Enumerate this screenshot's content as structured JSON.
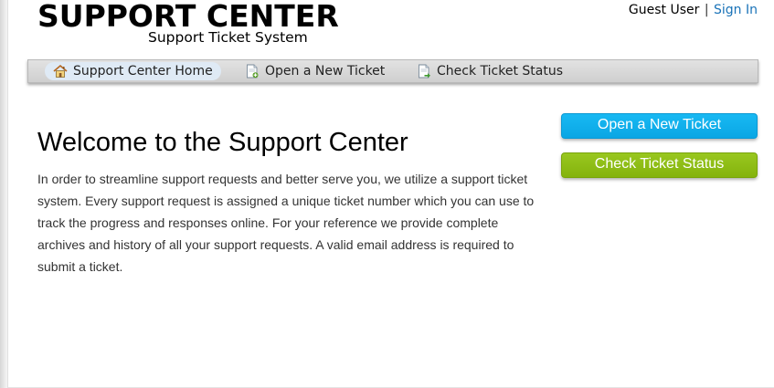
{
  "header": {
    "title": "SUPPORT CENTER",
    "subtitle": "Support Ticket System",
    "user_label": "Guest User",
    "separator": "|",
    "sign_in_label": "Sign In"
  },
  "nav": {
    "items": [
      {
        "label": "Support Center Home",
        "icon": "home-icon",
        "active": true
      },
      {
        "label": "Open a New Ticket",
        "icon": "new-ticket-icon",
        "active": false
      },
      {
        "label": "Check Ticket Status",
        "icon": "ticket-status-icon",
        "active": false
      }
    ]
  },
  "main": {
    "heading": "Welcome to the Support Center",
    "body": "In order to streamline support requests and better serve you, we utilize a support ticket system. Every support request is assigned a unique ticket number which you can use to track the progress and responses online. For your reference we provide complete archives and history of all your support requests. A valid email address is required to submit a ticket."
  },
  "sidebar": {
    "open_ticket_label": "Open a New Ticket",
    "check_status_label": "Check Ticket Status"
  },
  "colors": {
    "link": "#1a73b8",
    "open_button": "#0aa6e4",
    "check_button": "#84b30d",
    "nav_active_bg": "#dfeaf5"
  }
}
